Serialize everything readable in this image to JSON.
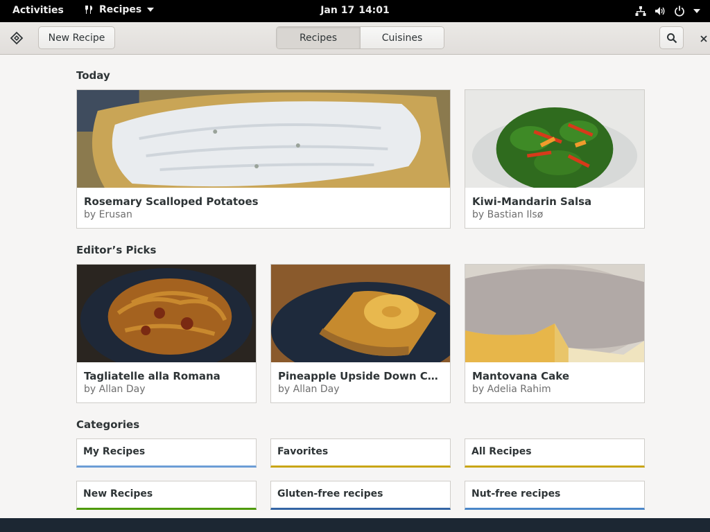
{
  "topbar": {
    "activities": "Activities",
    "app_name": "Recipes",
    "date": "Jan 17",
    "time": "14:01"
  },
  "headerbar": {
    "new_recipe_label": "New Recipe",
    "tabs": [
      {
        "label": "Recipes",
        "active": true
      },
      {
        "label": "Cuisines",
        "active": false
      }
    ]
  },
  "sections": {
    "today": "Today",
    "editors_picks": "Editor’s Picks",
    "categories": "Categories"
  },
  "today": [
    {
      "name": "Rosemary Scalloped Potatoes",
      "author": "by Erusan",
      "image": "scalloped-potatoes"
    },
    {
      "name": "Kiwi-Mandarin Salsa",
      "author": "by Bastian Ilsø",
      "image": "spinach-salad"
    }
  ],
  "editors_picks": [
    {
      "name": "Tagliatelle alla Romana",
      "author": "by Allan Day",
      "image": "tagliatelle"
    },
    {
      "name": "Pineapple Upside Down Cake …",
      "author": "by Allan Day",
      "image": "pineapple-cake"
    },
    {
      "name": "Mantovana Cake",
      "author": "by Adelia Rahim",
      "image": "mantovana-cake"
    }
  ],
  "categories": [
    {
      "label": "My Recipes",
      "color": "#6c9dd6"
    },
    {
      "label": "Favorites",
      "color": "#c9a515"
    },
    {
      "label": "All Recipes",
      "color": "#c9a515"
    },
    {
      "label": "New Recipes",
      "color": "#4e9a06"
    },
    {
      "label": "Gluten-free recipes",
      "color": "#3465a4"
    },
    {
      "label": "Nut-free recipes",
      "color": "#4a86c8"
    }
  ],
  "colors": {
    "topbar": "#000000",
    "window_bg": "#f6f5f4",
    "text": "#2e3436",
    "muted": "#6e6e6e"
  }
}
